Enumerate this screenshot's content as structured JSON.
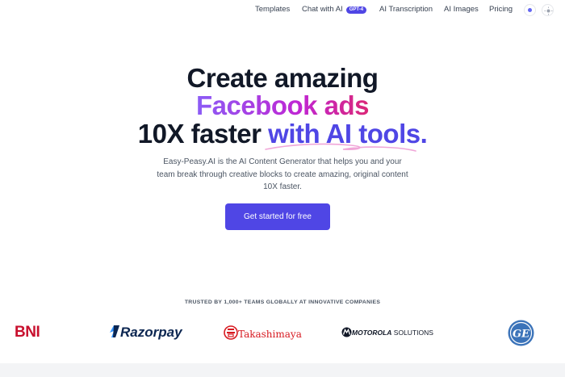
{
  "nav": {
    "links": [
      "Templates",
      "Chat with AI",
      "AI Transcription",
      "AI Images",
      "Pricing"
    ],
    "chat_badge": "GPT-4",
    "icons": [
      "language-icon",
      "theme-toggle-icon"
    ]
  },
  "hero": {
    "line1": "Create amazing",
    "line2": "Facebook ads",
    "line3_plain": "10X faster ",
    "line3_accent": "with AI tools.",
    "subtitle": "Easy-Peasy.AI is the AI Content Generator that helps you and your team break through creative blocks to create amazing, original content 10X faster.",
    "cta": "Get started for free"
  },
  "trusted": {
    "heading": "TRUSTED BY 1,000+ TEAMS GLOBALLY AT INNOVATIVE COMPANIES",
    "logos": {
      "bni": "BNI",
      "razorpay": "Razorpay",
      "takashimaya": "Takashimaya",
      "motorola_bold": "MOTOROLA",
      "motorola_light": " SOLUTIONS",
      "ge": "GE"
    }
  },
  "colors": {
    "accent": "#4f46e5",
    "gradient_start": "#8b5cf6",
    "gradient_end": "#db2777",
    "text_dark": "#111827"
  }
}
